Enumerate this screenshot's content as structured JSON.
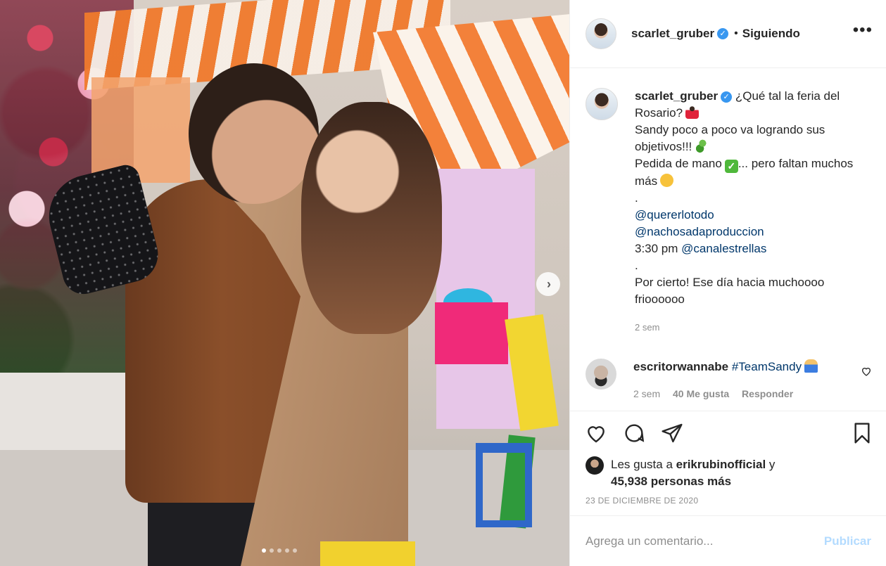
{
  "header": {
    "username": "scarlet_gruber",
    "separator": "•",
    "follow_status": "Siguiendo",
    "more_label": "•••",
    "verified_mark": "✓"
  },
  "caption": {
    "username": "scarlet_gruber",
    "line1": "¿Qué tal la feria del Rosario?",
    "line2": "Sandy poco a poco va logrando sus objetivos!!!",
    "line3": "Pedida de mano",
    "line3b": "... pero faltan muchos más",
    "dot1": ".",
    "mention1": "@quererlotodo",
    "mention2": "@nachosadaproduccion",
    "time_prefix": "3:30 pm",
    "mention3": "@canalestrellas",
    "dot2": ".",
    "closing": "Por cierto! Ese día hacia muchoooo frioooooo",
    "timestamp": "2 sem",
    "check_mark": "✓"
  },
  "comment": {
    "username": "escritorwannabe",
    "hashtag": "#TeamSandy",
    "timestamp": "2 sem",
    "likes": "40 Me gusta",
    "reply": "Responder"
  },
  "likes": {
    "prefix": "Les gusta a",
    "user": "erikrubinofficial",
    "and": "y",
    "others": "45,938 personas más"
  },
  "date": "23 DE DICIEMBRE DE 2020",
  "add_comment": {
    "placeholder": "Agrega un comentario...",
    "publish": "Publicar"
  },
  "carousel": {
    "dots": 5,
    "active_index": 0,
    "next_icon": "›"
  },
  "colors": {
    "link": "#00376b",
    "verified": "#3897f0",
    "publish_disabled": "#b3dbff",
    "muted": "#8e8e8e"
  },
  "icons": [
    "heart-icon",
    "comment-icon",
    "share-icon",
    "bookmark-icon",
    "verified-icon",
    "more-icon",
    "chevron-right-icon"
  ]
}
